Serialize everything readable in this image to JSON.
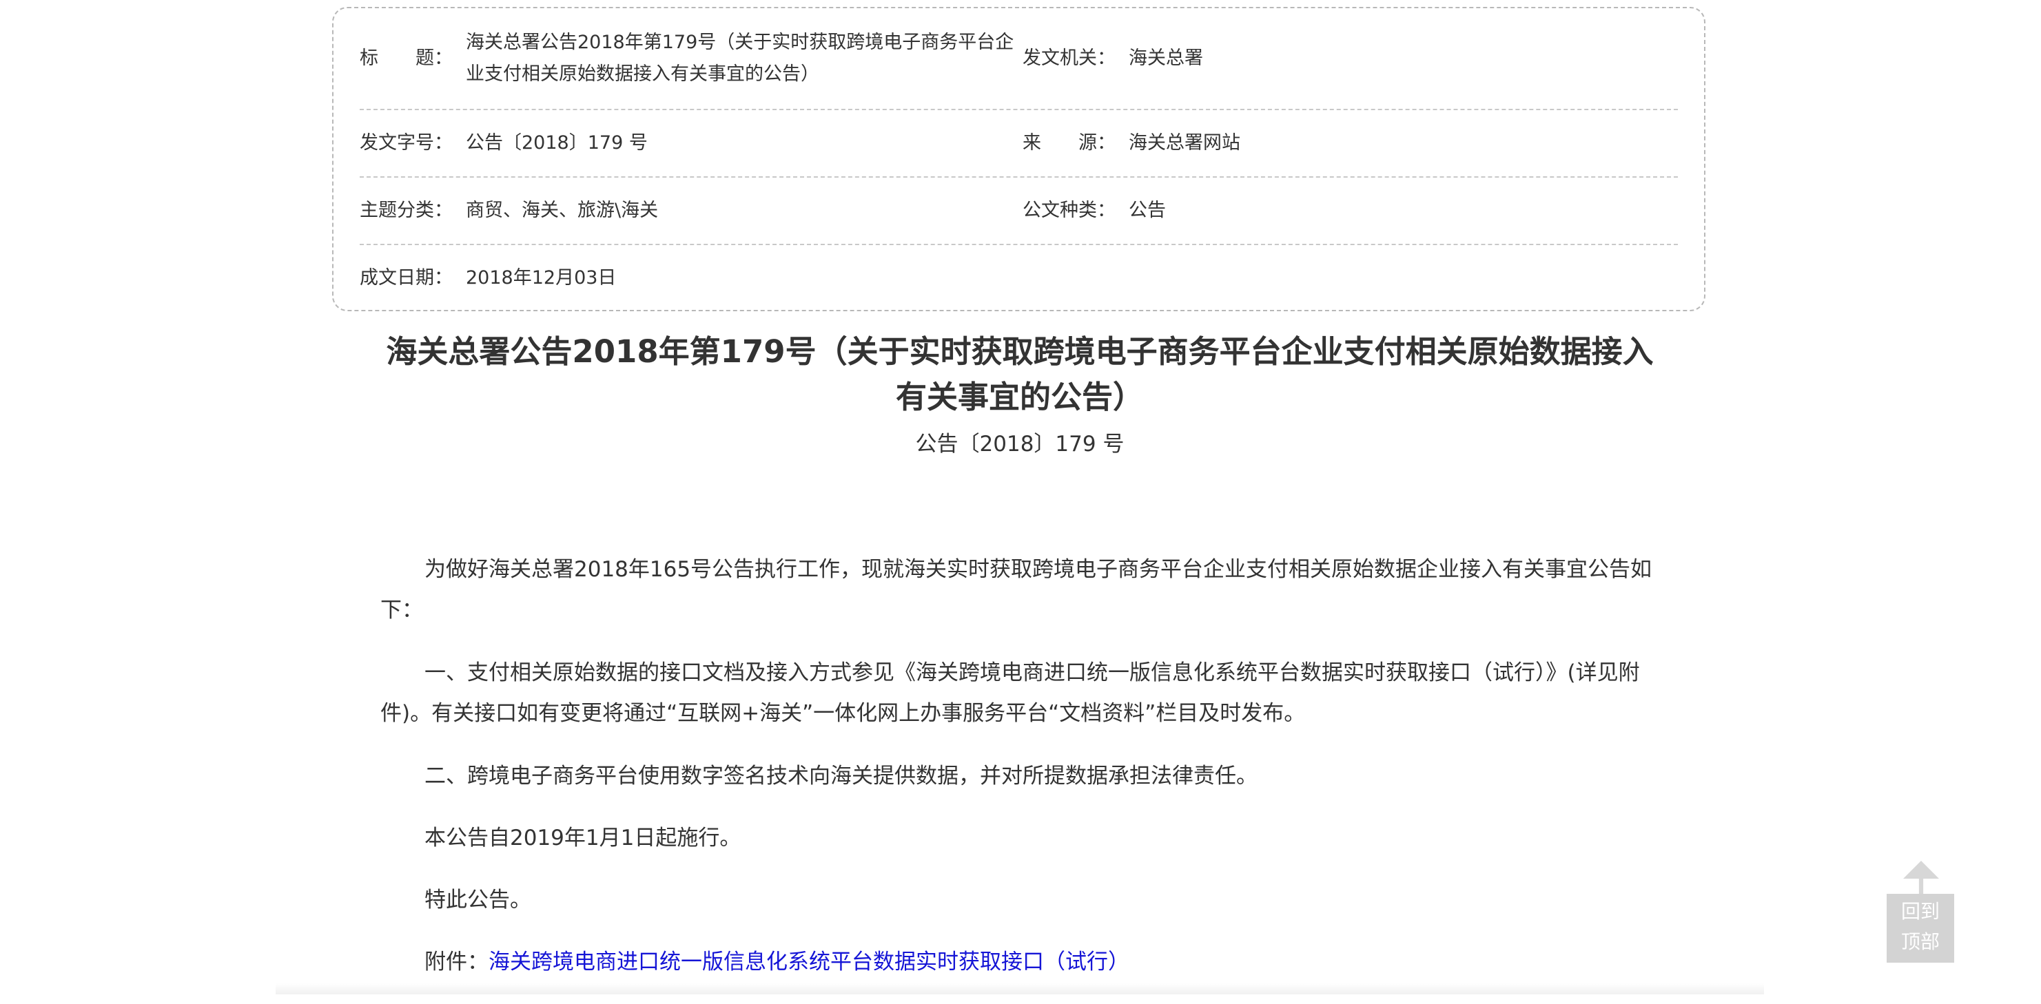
{
  "meta": {
    "title_label": "标　　题：",
    "title_value": "海关总署公告2018年第179号（关于实时获取跨境电子商务平台企业支付相关原始数据接入有关事宜的公告）",
    "issuer_label": "发文机关：",
    "issuer_value": "海关总署",
    "doc_no_label": "发文字号：",
    "doc_no_value": "公告〔2018〕179 号",
    "source_label": "来　　源：",
    "source_value": "海关总署网站",
    "topic_label": "主题分类：",
    "topic_value": "商贸、海关、旅游\\海关",
    "type_label": "公文种类：",
    "type_value": "公告",
    "date_label": "成文日期：",
    "date_value": "2018年12月03日"
  },
  "document": {
    "title": "海关总署公告2018年第179号（关于实时获取跨境电子商务平台企业支付相关原始数据接入有关事宜的公告）",
    "number": "公告〔2018〕179 号",
    "paragraphs": [
      "为做好海关总署2018年165号公告执行工作，现就海关实时获取跨境电子商务平台企业支付相关原始数据企业接入有关事宜公告如下：",
      "一、支付相关原始数据的接口文档及接入方式参见《海关跨境电商进口统一版信息化系统平台数据实时获取接口（试行）》(详见附件)。有关接口如有变更将通过“互联网+海关”一体化网上办事服务平台“文档资料”栏目及时发布。",
      "二、跨境电子商务平台使用数字签名技术向海关提供数据，并对所提数据承担法律责任。",
      "本公告自2019年1月1日起施行。",
      "特此公告。"
    ],
    "attachment_label": "附件：",
    "attachment_link": "海关跨境电商进口统一版信息化系统平台数据实时获取接口（试行）"
  },
  "back_to_top": {
    "line1": "回到",
    "line2": "顶部"
  },
  "colors": {
    "text": "#333333",
    "link": "#1515d6",
    "border": "#b8b8b8",
    "back_to_top_bg": "#d3d3d3"
  }
}
